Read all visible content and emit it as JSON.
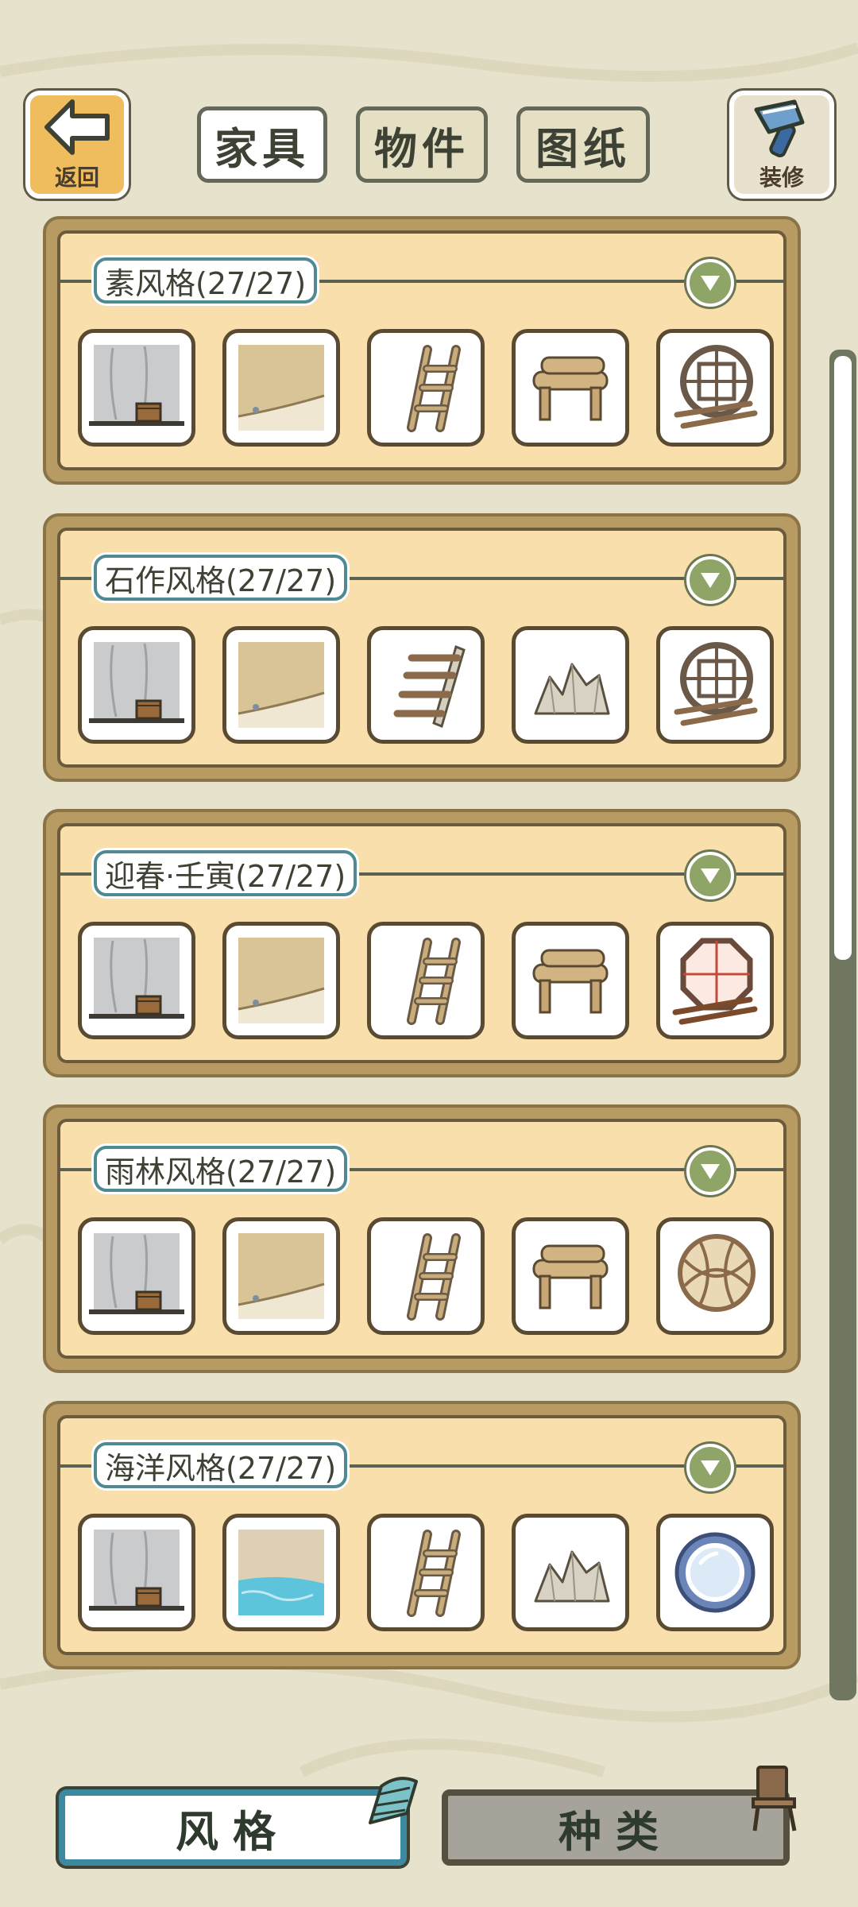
{
  "header": {
    "back_label": "返回",
    "decorate_label": "装修",
    "tabs": [
      {
        "label": "家具",
        "active": true
      },
      {
        "label": "物件",
        "active": false
      },
      {
        "label": "图纸",
        "active": false
      }
    ]
  },
  "sets": [
    {
      "title": "素风格(27/27)",
      "items": [
        "wall-icon",
        "floor-icon",
        "ladder-icon",
        "bench-icon",
        "round-window-icon"
      ]
    },
    {
      "title": "石作风格(27/27)",
      "items": [
        "wall-icon",
        "floor-icon",
        "stairs-icon",
        "rock-icon",
        "round-window-icon"
      ]
    },
    {
      "title": "迎春·壬寅(27/27)",
      "items": [
        "wall-icon",
        "floor-icon",
        "ladder-icon",
        "bench-icon",
        "octagon-window-icon"
      ]
    },
    {
      "title": "雨林风格(27/27)",
      "items": [
        "wall-icon",
        "floor-icon",
        "ladder-icon",
        "bench-icon",
        "woven-ball-icon"
      ]
    },
    {
      "title": "海洋风格(27/27)",
      "items": [
        "wall-icon",
        "water-floor-icon",
        "ladder-icon",
        "rock-icon",
        "porthole-icon"
      ]
    }
  ],
  "bottom_tabs": {
    "style_label": "风格",
    "type_label": "种类"
  },
  "colors": {
    "background": "#e6e2cc",
    "panel": "#f8dfab",
    "accent": "#3d8aa0",
    "collapse": "#8fa467"
  }
}
